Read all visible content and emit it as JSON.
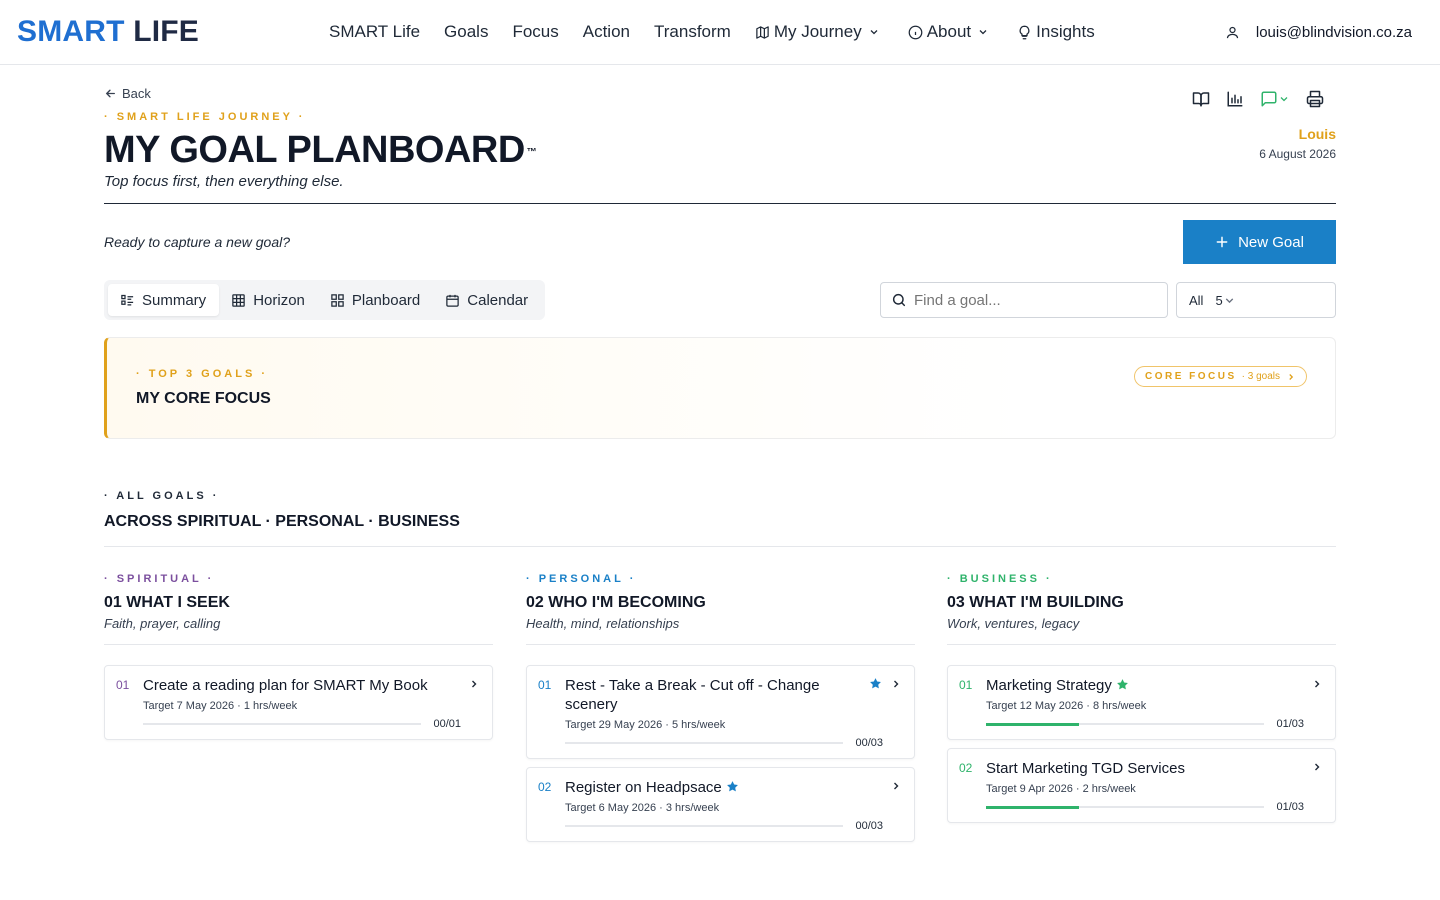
{
  "brand": {
    "part1": "SMART",
    "part2": " LIFE",
    "color": "#1f6fd1"
  },
  "nav": {
    "items": [
      {
        "label": "SMART Life",
        "icon": ""
      },
      {
        "label": "Goals",
        "icon": ""
      },
      {
        "label": "Focus",
        "icon": ""
      },
      {
        "label": "Action",
        "icon": ""
      },
      {
        "label": "Transform",
        "icon": ""
      },
      {
        "label": "My Journey",
        "icon": "map-icon",
        "dropdown": true
      },
      {
        "label": "About",
        "icon": "info-icon",
        "dropdown": true
      },
      {
        "label": "Insights",
        "icon": "lightbulb-icon",
        "dropdown": false
      }
    ],
    "user_email": "louis@blindvision.co.za"
  },
  "header": {
    "back_label": "Back",
    "overline": "· SMART LIFE JOURNEY ·",
    "title": "MY GOAL PLANBOARD",
    "trademark": "™",
    "subtitle": "Top focus first, then everything else.",
    "user_name": "Louis",
    "date": "6 August 2026",
    "tool_icons": [
      "book-icon",
      "bar-chart-icon",
      "comment-icon",
      "printer-icon"
    ]
  },
  "actions": {
    "prompt": "Ready to capture a new goal?",
    "new_goal_label": "New Goal"
  },
  "tabs": [
    {
      "label": "Summary",
      "icon": "list-icon",
      "active": true
    },
    {
      "label": "Horizon",
      "icon": "table-icon",
      "active": false
    },
    {
      "label": "Planboard",
      "icon": "grid-icon",
      "active": false
    },
    {
      "label": "Calendar",
      "icon": "calendar-icon",
      "active": false
    }
  ],
  "search": {
    "placeholder": "Find a goal..."
  },
  "filter": {
    "value": "All",
    "count": "5"
  },
  "core_focus": {
    "overline": "· TOP 3 GOALS ·",
    "title": "MY CORE FOCUS",
    "pill_label": "CORE FOCUS",
    "pill_count": "· 3 goals"
  },
  "all_goals": {
    "overline": "· ALL GOALS ·",
    "title": "ACROSS SPIRITUAL · PERSONAL · BUSINESS"
  },
  "colors": {
    "accent": "#1a80c7",
    "gold": "#e0a11b",
    "spiritual": "#7b4f9e",
    "personal": "#1a80c7",
    "business": "#2fb36b"
  },
  "columns": [
    {
      "key": "spiritual",
      "overline": "· SPIRITUAL ·",
      "heading": "01 WHAT I SEEK",
      "subheading": "Faith, prayer, calling",
      "goals": [
        {
          "num": "01",
          "title": "Create a reading plan for SMART My Book",
          "star": false,
          "meta": "Target 7 May 2026 · 1 hrs/week",
          "progress": "00/01",
          "fraction": 0.0
        }
      ]
    },
    {
      "key": "personal",
      "overline": "· PERSONAL ·",
      "heading": "02 WHO I'M BECOMING",
      "subheading": "Health, mind, relationships",
      "goals": [
        {
          "num": "01",
          "title": "Rest - Take a Break - Cut off - Change scenery",
          "star": true,
          "meta": "Target 29 May 2026 · 5 hrs/week",
          "progress": "00/03",
          "fraction": 0.0
        },
        {
          "num": "02",
          "title": "Register on Headpsace",
          "star": true,
          "meta": "Target 6 May 2026 · 3 hrs/week",
          "progress": "00/03",
          "fraction": 0.0
        }
      ]
    },
    {
      "key": "business",
      "overline": "· BUSINESS ·",
      "heading": "03 WHAT I'M BUILDING",
      "subheading": "Work, ventures, legacy",
      "goals": [
        {
          "num": "01",
          "title": "Marketing Strategy",
          "star": true,
          "meta": "Target 12 May 2026 · 8 hrs/week",
          "progress": "01/03",
          "fraction": 0.333
        },
        {
          "num": "02",
          "title": "Start Marketing TGD Services",
          "star": false,
          "meta": "Target 9 Apr 2026 · 2 hrs/week",
          "progress": "01/03",
          "fraction": 0.333
        }
      ]
    }
  ]
}
